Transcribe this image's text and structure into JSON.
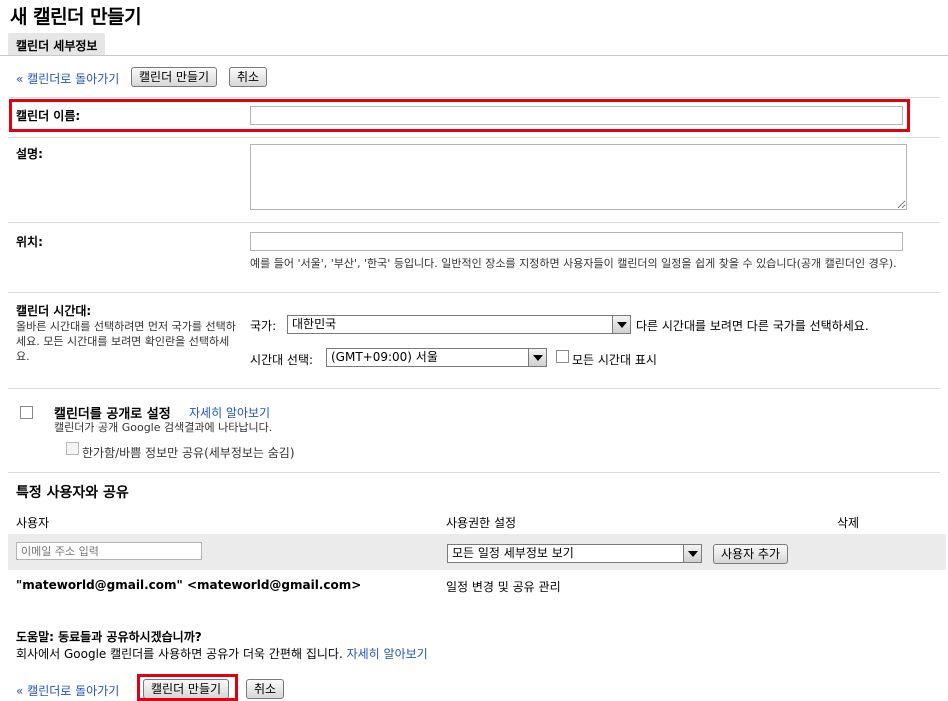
{
  "page": {
    "title": "새 캘린더 만들기",
    "tab": "캘린더 세부정보"
  },
  "nav": {
    "back": "« 캘린더로 돌아가기",
    "create": "캘린더 만들기",
    "cancel": "취소"
  },
  "form": {
    "name_label": "캘린더 이름:",
    "desc_label": "설명:",
    "location_label": "위치:",
    "location_help": "예를 들어 '서울', '부산', '한국' 등입니다. 일반적인 장소를 지정하면 사용자들이 캘린더의 일정을 쉽게 찾을 수 있습니다(공개 캘린더인 경우).",
    "tz_label": "캘린더 시간대:",
    "tz_help": "올바른 시간대를 선택하려면 먼저 국가를 선택하세요. 모든 시간대를 보려면 확인란을 선택하세요.",
    "country_label": "국가:",
    "country_value": "대한민국",
    "country_hint": "다른 시간대를 보려면 다른 국가를 선택하세요.",
    "tz_select_label": "시간대 선택:",
    "tz_value": "(GMT+09:00) 서울",
    "show_all_tz": "모든 시간대 표시"
  },
  "public": {
    "label": "캘린더를 공개로 설정",
    "learn_more": "자세히 알아보기",
    "sub": "캘린더가 공개 Google 검색결과에 나타납니다.",
    "freebusy": "한가함/바쁨 정보만 공유(세부정보는 숨김)"
  },
  "share": {
    "heading": "특정 사용자와 공유",
    "col_user": "사용자",
    "col_perm": "사용권한 설정",
    "col_delete": "삭제",
    "email_placeholder": "이메일 주소 입력",
    "perm_value": "모든 일정 세부정보 보기",
    "add_user": "사용자 추가",
    "owner": "\"mateworld@gmail.com\" <mateworld@gmail.com>",
    "owner_perm": "일정 변경 및 공유 관리"
  },
  "help": {
    "title": "도움말: 동료들과 공유하시겠습니까?",
    "text": "회사에서 Google 캘린더를 사용하면 공유가 더욱 간편해 집니다.",
    "learn_more": "자세히 알아보기"
  }
}
